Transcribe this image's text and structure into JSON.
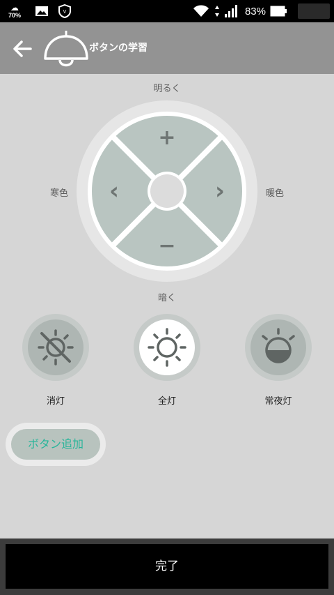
{
  "status_bar": {
    "weather_percent": "70%",
    "battery_percent": "83%"
  },
  "header": {
    "title": "ボタンの学習"
  },
  "labels": {
    "top": "明るく",
    "bottom": "暗く",
    "left": "寒色",
    "right": "暖色"
  },
  "dpad": {
    "up_glyph": "+",
    "down_glyph": "−",
    "left_glyph": "‹",
    "right_glyph": "›"
  },
  "presets": [
    {
      "label": "消灯",
      "icon": "light-off-icon"
    },
    {
      "label": "全灯",
      "icon": "sun-icon"
    },
    {
      "label": "常夜灯",
      "icon": "night-light-icon"
    }
  ],
  "add_button": {
    "label": "ボタン追加"
  },
  "done_button": {
    "label": "完了"
  },
  "colors": {
    "header_bg": "#939393",
    "body_bg": "#d6d6d6",
    "dpad_fill": "#b9c5c1",
    "accent_green": "#27b59a"
  }
}
